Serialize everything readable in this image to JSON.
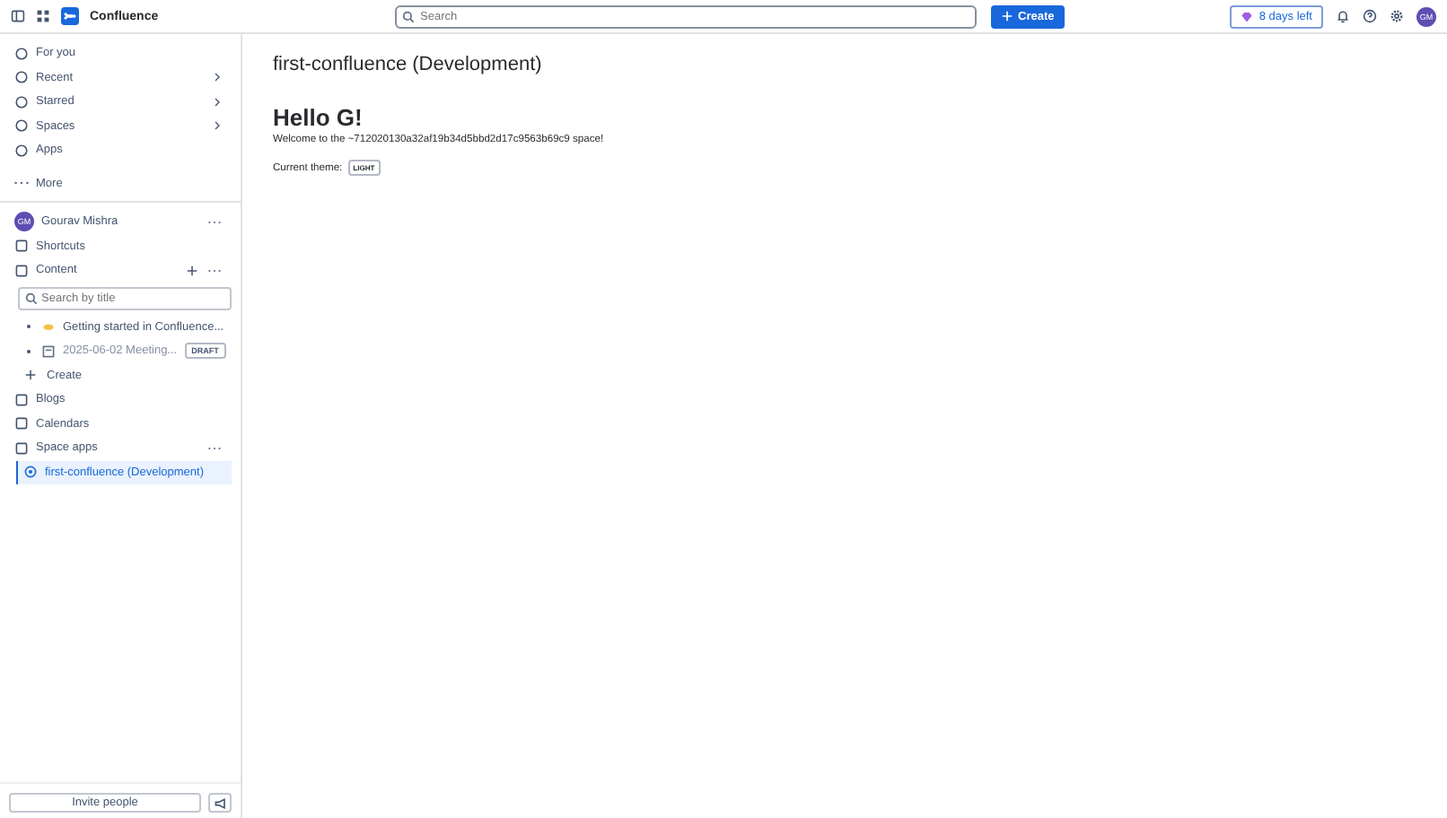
{
  "topbar": {
    "product": "Confluence",
    "search": {
      "placeholder": "Search"
    },
    "create": "Create",
    "trial": "8 days left",
    "avatar": "GM"
  },
  "nav": [
    {
      "label": "For you",
      "expandable": false
    },
    {
      "label": "Recent",
      "expandable": true
    },
    {
      "label": "Starred",
      "expandable": true
    },
    {
      "label": "Spaces",
      "expandable": true
    },
    {
      "label": "Apps",
      "expandable": false
    }
  ],
  "more": "More",
  "space": {
    "avatar": "GM",
    "name": "Gourav Mishra",
    "sections": [
      {
        "label": "Shortcuts",
        "kind": "plain"
      },
      {
        "label": "Content",
        "kind": "content"
      }
    ],
    "filter": {
      "placeholder": "Search by title"
    },
    "pages": [
      {
        "title": "Getting started in Confluence...",
        "kind": "page"
      },
      {
        "title": "2025-06-02 Meeting...",
        "kind": "draft",
        "badge": "DRAFT"
      }
    ],
    "create": "Create",
    "more_sections": [
      {
        "label": "Blogs"
      },
      {
        "label": "Calendars"
      },
      {
        "label": "Space apps"
      }
    ],
    "apps": [
      {
        "label": "first-confluence (Development)",
        "selected": true
      }
    ]
  },
  "invite": "Invite people",
  "page": {
    "title": "first-confluence (Development)",
    "heading": "Hello G!",
    "welcome": "Welcome to the ~712020130a32af19b34d5bbd2d17c9563b69c9 space!",
    "theme_label": "Current theme:",
    "theme": "LIGHT"
  }
}
